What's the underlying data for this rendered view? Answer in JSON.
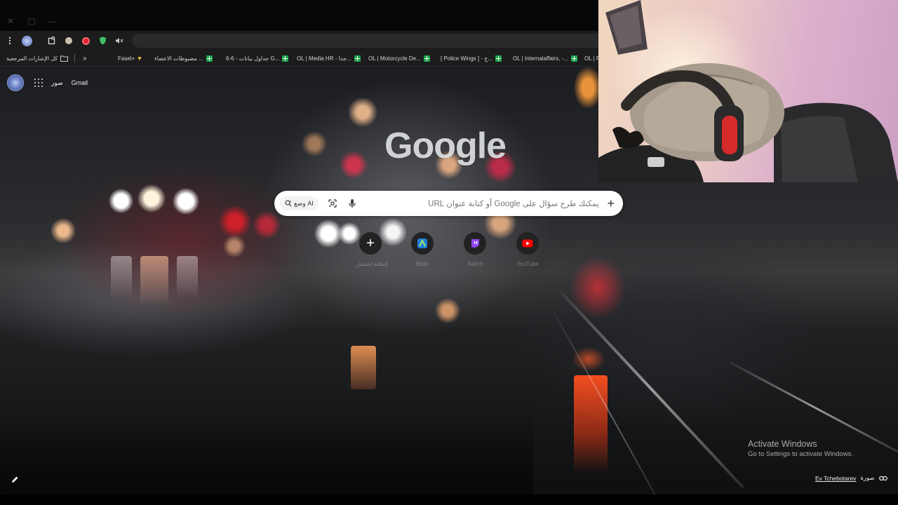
{
  "browser": {
    "window_controls": {
      "close": "✕",
      "restore": "▢",
      "minimize": "—"
    },
    "toolbar_icons": [
      "menu-icon",
      "globe-icon",
      "extensions-icon",
      "extension-icon",
      "opera-icon",
      "shield-icon",
      "mute-icon"
    ],
    "bookmarks": {
      "all_bookmarks_label": "كل الإشارات المرجعية",
      "overflow": "»",
      "items": [
        {
          "label": "Fasel+",
          "icon": "heart-icon"
        },
        {
          "label": "مضبوطات الاعضاء ...",
          "icon": "sheets-icon"
        },
        {
          "label": "6-6 - جداول بيانات G...",
          "icon": "sheets-icon"
        },
        {
          "label": "OL | Media HR - جدا...",
          "icon": "sheets-icon"
        },
        {
          "label": "OL | Motorcycle De...",
          "icon": "sheets-icon"
        },
        {
          "label": "[ Police Wings ] - ج...",
          "icon": "sheets-icon"
        },
        {
          "label": "OL | Internalaffairs, -...",
          "icon": "sheets-icon"
        },
        {
          "label": "OL | F",
          "icon": "sheets-icon"
        }
      ]
    }
  },
  "ntp": {
    "top_links": {
      "gmail": "Gmail",
      "images": "صور"
    },
    "logo": "Google",
    "search": {
      "placeholder": "يمكنك طرح سؤال على Google أو كتابة عنوان URL",
      "ai_mode": "وضع AI"
    },
    "shortcuts": [
      {
        "label": "إضافة اختصار",
        "icon": "plus-icon",
        "color": "#ffffff"
      },
      {
        "label": "Elsin",
        "icon": "app-icon",
        "color": "#3a8de0"
      },
      {
        "label": "Twitch",
        "icon": "twitch-icon",
        "color": "#9146ff"
      },
      {
        "label": "YouTube",
        "icon": "youtube-icon",
        "color": "#ff0000"
      }
    ],
    "background_credit": {
      "prefix": "صورة",
      "author": "Ev Tchebotarev"
    }
  },
  "windows_watermark": {
    "title": "Activate Windows",
    "subtitle": "Go to Settings to activate Windows."
  },
  "colors": {
    "sheets_green": "#1aa34a",
    "omnibox": "#2a2a2a",
    "toolbar": "#1c1c1c"
  }
}
